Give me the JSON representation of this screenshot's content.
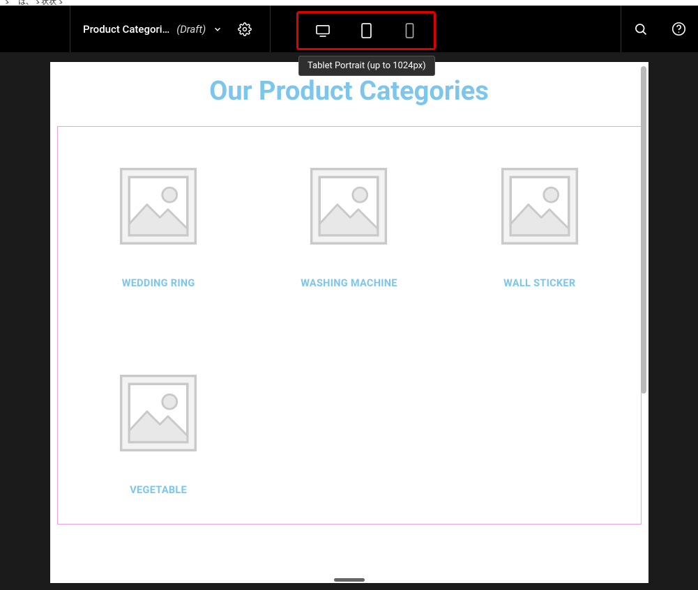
{
  "fragment_text": "ゝ゜は、ゝ状状ゝ",
  "header": {
    "page_title": "Product Categori…",
    "status": "(Draft)"
  },
  "devices": {
    "tooltip": "Tablet Portrait (up to 1024px)",
    "active": "tablet"
  },
  "page": {
    "heading": "Our Product Categories",
    "categories": [
      {
        "label": "WEDDING RING"
      },
      {
        "label": "WASHING MACHINE"
      },
      {
        "label": "WALL STICKER"
      },
      {
        "label": "VEGETABLE"
      }
    ]
  }
}
